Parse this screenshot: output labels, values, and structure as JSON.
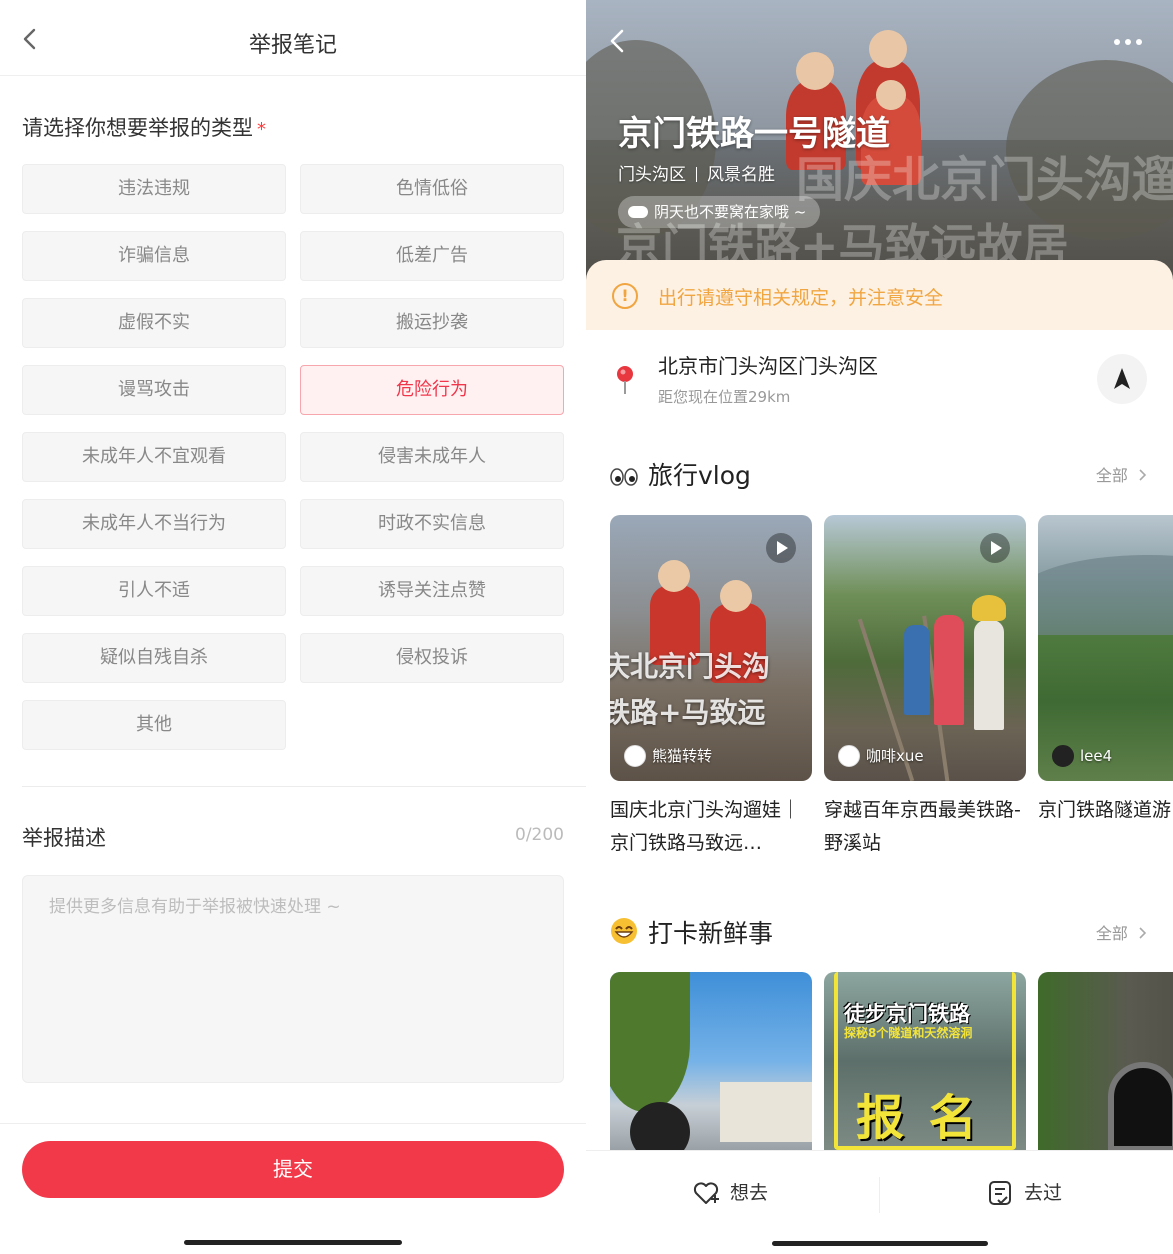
{
  "report": {
    "nav_title": "举报笔记",
    "heading": "请选择你想要举报的类型",
    "required_mark": "*",
    "types": [
      {
        "label": "违法违规",
        "selected": false
      },
      {
        "label": "色情低俗",
        "selected": false
      },
      {
        "label": "诈骗信息",
        "selected": false
      },
      {
        "label": "低差广告",
        "selected": false
      },
      {
        "label": "虚假不实",
        "selected": false
      },
      {
        "label": "搬运抄袭",
        "selected": false
      },
      {
        "label": "谩骂攻击",
        "selected": false
      },
      {
        "label": "危险行为",
        "selected": true
      },
      {
        "label": "未成年人不宜观看",
        "selected": false
      },
      {
        "label": "侵害未成年人",
        "selected": false
      },
      {
        "label": "未成年人不当行为",
        "selected": false
      },
      {
        "label": "时政不实信息",
        "selected": false
      },
      {
        "label": "引人不适",
        "selected": false
      },
      {
        "label": "诱导关注点赞",
        "selected": false
      },
      {
        "label": "疑似自残自杀",
        "selected": false
      },
      {
        "label": "侵权投诉",
        "selected": false
      },
      {
        "label": "其他",
        "selected": false
      }
    ],
    "description_label": "举报描述",
    "description_count": "0/200",
    "description_placeholder": "提供更多信息有助于举报被快速处理 ~",
    "submit_label": "提交",
    "colors": {
      "accent": "#f2394a",
      "selected_text": "#f0364b",
      "selected_border": "#f7a6ad"
    }
  },
  "place": {
    "title": "京门铁路一号隧道",
    "district": "门头沟区",
    "category": "风景名胜",
    "weather_tip": "阴天也不要窝在家哦 ~",
    "hero_watermark_line1": "国庆北京门头沟遛娃",
    "hero_watermark_line2": "京门铁路+马致远故居",
    "safety_notice": "出行请遵守相关规定，并注意安全",
    "address": "北京市门头沟区门头沟区",
    "distance": "距您现在位置29km",
    "vlog_section": {
      "title": "旅行vlog",
      "more": "全部",
      "cards": [
        {
          "author": "熊猫转转",
          "title": "国庆北京门头沟遛娃｜京门铁路马致远…",
          "overlay_line1": "庆北京门头沟",
          "overlay_line2": "铁路+马致远",
          "has_play": true
        },
        {
          "author": "咖啡xue",
          "title": "穿越百年京西最美铁路-野溪站",
          "has_play": true
        },
        {
          "author": "lee4",
          "title": "京门铁路隧道游",
          "has_play": false
        }
      ]
    },
    "checkin_section": {
      "title": "打卡新鲜事",
      "more": "全部",
      "card2_banner_line1": "徒步京门铁路",
      "card2_banner_line2": "探秘8个隧道和天然溶洞",
      "card2_big": "报 名"
    },
    "tabbar": {
      "want": "想去",
      "been": "去过"
    },
    "colors": {
      "warn": "#f1a540",
      "warn_bg": "#fdf1e4",
      "pin": "#e8373f"
    }
  }
}
